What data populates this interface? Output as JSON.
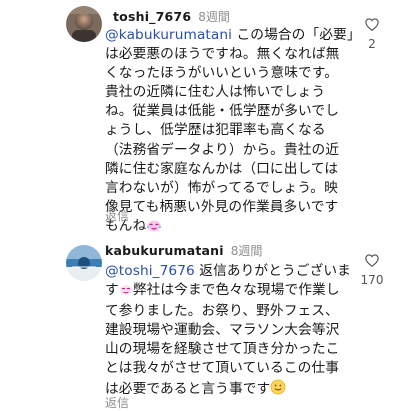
{
  "comments": [
    {
      "username": "toshi_7676",
      "time": "8週間",
      "mention": "@kabukurumatani",
      "text_lines": [
        "この場合の「必要」",
        "は必要悪のほうですね。無くなれば無",
        "くなったほうがいいという意味です。",
        "貴社の近隣に住む人は怖いでしょう",
        "ね。従業員は低能・低学歴が多いでし",
        "ょうし、低学歴は犯罪率も高くなる",
        "（法務省データより）から。貴社の近",
        "隣に住む家庭なんかは（口に出しては",
        "言わないが）怖がってるでしょう。映",
        "像見ても柄悪い外見の作業員多いです",
        "もんね"
      ],
      "end_emoji": "face-with-tears-icon",
      "reply_label": "返信",
      "like_count": "2"
    },
    {
      "username": "kabukurumatani",
      "time": "8週間",
      "mention": "@toshi_7676",
      "text_lines": [
        " 返信ありがとうございま",
        "す  弊社は今まで色々な現場で作業し",
        "て参りました。お祭り、野外フェス、",
        "建設現場や運動会、マラソン大会等沢",
        "山の現場を経験させて頂き分かったこ",
        "とは我々がさせて頂いているこの仕事",
        "は必要であると言う事です"
      ],
      "mid_emoji": "sparkle-face-icon",
      "end_emoji": "smiling-face-icon",
      "reply_label": "返信",
      "like_count": "170"
    }
  ],
  "colors": {
    "mention": "#2a4fa8",
    "meta": "#8e8e8e",
    "text": "#1a1a1a"
  }
}
